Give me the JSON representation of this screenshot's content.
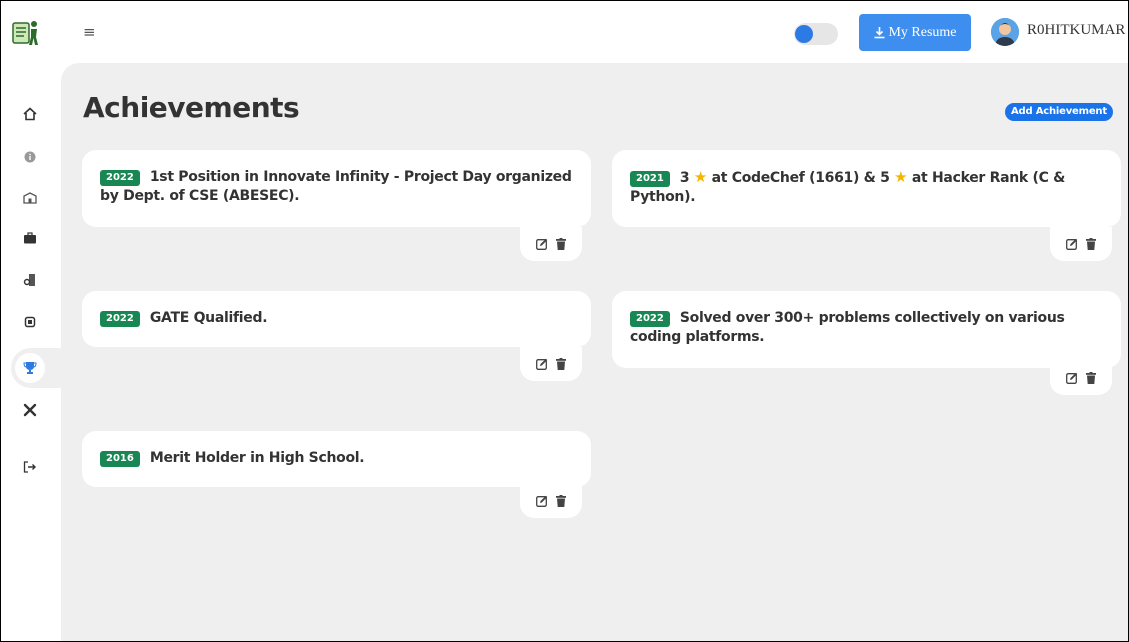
{
  "header": {
    "menu_icon": "hamburger-icon",
    "theme_toggle": "off",
    "resume_button": "My Resume",
    "username": "R0HITKUMAR"
  },
  "sidebar": {
    "items": [
      {
        "icon": "home-icon"
      },
      {
        "icon": "info-icon"
      },
      {
        "icon": "education-icon"
      },
      {
        "icon": "briefcase-icon"
      },
      {
        "icon": "certificate-icon"
      },
      {
        "icon": "chip-icon"
      },
      {
        "icon": "trophy-icon",
        "active": true
      },
      {
        "icon": "tools-icon"
      },
      {
        "icon": "logout-icon"
      }
    ]
  },
  "main": {
    "title": "Achievements",
    "add_button": "Add Achievement",
    "achievements": [
      {
        "year": "2022",
        "text": "1st Position in Innovate Infinity - Project Day organized by Dept. of CSE (ABESEC)."
      },
      {
        "year": "2021",
        "text_a": "3",
        "text_b": "at CodeChef (1661) & 5",
        "text_c": "at Hacker Rank (C & Python)."
      },
      {
        "year": "2022",
        "text": "GATE Qualified."
      },
      {
        "year": "2022",
        "text": "Solved over 300+ problems collectively on various coding platforms."
      },
      {
        "year": "2016",
        "text": "Merit Holder in High School."
      }
    ]
  },
  "colors": {
    "accent": "#1a73e8",
    "resume_button": "#3d8eef",
    "year_badge": "#198754",
    "star": "#f5b400",
    "background": "#efefef"
  }
}
